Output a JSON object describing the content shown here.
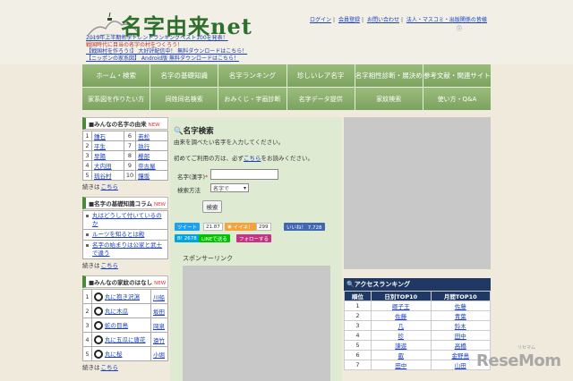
{
  "header": {
    "title": "名字由来net",
    "promo": [
      {
        "text": "2019年上半期名字トレンドランキングベスト100を発表！",
        "style": "blue"
      },
      {
        "text": "戦国時代に目当の名字の村をつくろう！",
        "style": "red"
      },
      {
        "text": "【戦国村を作ろう!】 大好評配信中！ 無料ダウンロードはこちら！",
        "style": "blue"
      },
      {
        "text": "【ニッポンの家系図】 Android版 無料ダウンロードはこちら！",
        "style": "blue"
      }
    ],
    "top_links": [
      "ログイン",
      "会員登録",
      "お問い合わせ",
      "法人・マスコミ・出版関係の皆様"
    ],
    "help_mark": "ⓘ"
  },
  "nav": {
    "row1": [
      "ホーム・検索",
      "名字の基礎知識",
      "名字ランキング",
      "珍しいレア名字",
      "名字相性診断・展決め",
      "参考文献・関連サイト"
    ],
    "row2": [
      "家系図を作りたい方",
      "同姓同名検索",
      "おみくじ・字画診断",
      "名字データ提供",
      "家紋検索",
      "使い方・Q&A"
    ]
  },
  "left": {
    "origin_box": {
      "title": "■みんなの名字の由来",
      "new": "NEW",
      "rows": [
        {
          "n1": "1",
          "a": "鍾石",
          "n2": "6",
          "b": "若松"
        },
        {
          "n1": "2",
          "a": "平生",
          "n2": "7",
          "b": "執行"
        },
        {
          "n1": "3",
          "a": "早陽",
          "n2": "8",
          "b": "櫻部"
        },
        {
          "n1": "4",
          "a": "大内田",
          "n2": "9",
          "b": "奈古屋"
        },
        {
          "n1": "5",
          "a": "琉谷村",
          "n2": "10",
          "b": "鐘坂"
        }
      ],
      "more_prefix": "続きは",
      "more_link": "こちら"
    },
    "column_box": {
      "title": "■名字の基礎知識コラム",
      "new": "NEW",
      "items": [
        "丸はどうして付いているのか",
        "ルーツを知るとは殿",
        "名字の始まりは公家と武士で違う"
      ],
      "more_prefix": "続きは",
      "more_link": "こちら"
    },
    "crest_box": {
      "title": "■みんなの家紋のはなし",
      "new": "NEW",
      "rows": [
        {
          "n": "1",
          "crest": "丸に抱き沢瀉",
          "name": "川船"
        },
        {
          "n": "2",
          "crest": "丸に木瓜",
          "name": "坂田"
        },
        {
          "n": "3",
          "crest": "蛇の目島",
          "name": "岡泉"
        },
        {
          "n": "4",
          "crest": "丸に五瓜に唐花",
          "name": "遠竹"
        },
        {
          "n": "5",
          "crest": "丸に桜",
          "name": "小堀"
        }
      ],
      "more_prefix": "続きは",
      "more_link": "こちら"
    }
  },
  "center": {
    "title": "名字検索",
    "intro": "由来を調べたい名字を入力してください。",
    "first_time_prefix": "初めてご利用の方は、必ず",
    "first_time_link": "こちら",
    "first_time_suffix": "をお読みください。",
    "name_label": "名字(漢字)",
    "required_mark": "*",
    "name_value": "",
    "method_label": "検索方法",
    "method_value": "名字で",
    "search_button": "検索",
    "sns": {
      "tweet": "ツイート",
      "tweet_count": "21.87",
      "iine": "イイネ！",
      "iine_count": "299",
      "fb_like": "いいね！ 7,728",
      "hatena": "B! 2678",
      "line": "LINEで送る",
      "instagram": "フォローする"
    },
    "sponsor_label": "スポンサーリンク"
  },
  "right": {
    "access_title": "アクセスランキング",
    "headers": [
      "順位",
      "日別TOP10",
      "月間TOP10"
    ],
    "rows": [
      {
        "rank": "1",
        "daily": "卿子王",
        "monthly": "佐藤"
      },
      {
        "rank": "2",
        "daily": "佐藤",
        "monthly": "青葉"
      },
      {
        "rank": "3",
        "daily": "几",
        "monthly": "鈴木"
      },
      {
        "rank": "4",
        "daily": "珍",
        "monthly": "田中"
      },
      {
        "rank": "5",
        "daily": "諫遊",
        "monthly": "高橋"
      },
      {
        "rank": "6",
        "daily": "叡",
        "monthly": "金野島"
      },
      {
        "rank": "7",
        "daily": "田中",
        "monthly": "山田"
      }
    ]
  },
  "watermark": "ReseMom",
  "watermark_sub": "リセマム"
}
